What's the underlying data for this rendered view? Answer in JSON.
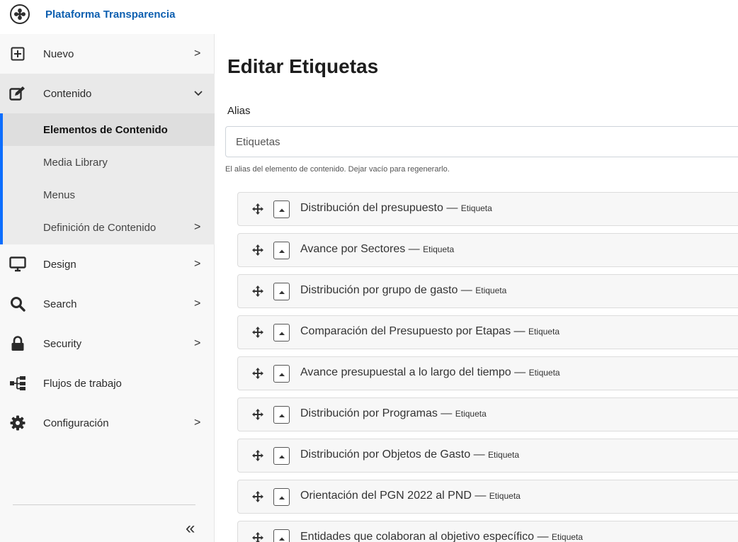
{
  "app": {
    "brand": "Plataforma Transparencia"
  },
  "sidebar": {
    "items": [
      {
        "label": "Nuevo",
        "icon": "plus-square-icon",
        "has_arrow": true
      },
      {
        "label": "Contenido",
        "icon": "edit-icon",
        "expanded": true
      },
      {
        "label": "Design",
        "icon": "monitor-icon",
        "has_arrow": true
      },
      {
        "label": "Search",
        "icon": "search-icon",
        "has_arrow": true
      },
      {
        "label": "Security",
        "icon": "lock-icon",
        "has_arrow": true
      },
      {
        "label": "Flujos de trabajo",
        "icon": "workflow-icon",
        "has_arrow": false
      },
      {
        "label": "Configuración",
        "icon": "gear-icon",
        "has_arrow": true
      }
    ],
    "content_submenu": [
      {
        "label": "Elementos de Contenido",
        "selected": true
      },
      {
        "label": "Media Library"
      },
      {
        "label": "Menus"
      },
      {
        "label": "Definición de Contenido",
        "has_arrow": true
      }
    ],
    "arrow_right": ">",
    "arrow_down": "⌄",
    "collapse_glyph": "«"
  },
  "main": {
    "title": "Editar Etiquetas",
    "alias_label": "Alias",
    "alias_value": "Etiquetas",
    "alias_hint": "El alias del elemento de contenido. Dejar vacío para regenerarlo.",
    "separator": " — ",
    "items": [
      {
        "title": "Distribución del presupuesto",
        "type": "Etiqueta"
      },
      {
        "title": "Avance por Sectores",
        "type": "Etiqueta"
      },
      {
        "title": "Distribución por grupo de gasto",
        "type": "Etiqueta"
      },
      {
        "title": "Comparación del Presupuesto por Etapas",
        "type": "Etiqueta"
      },
      {
        "title": "Avance presupuestal a lo largo del tiempo",
        "type": "Etiqueta"
      },
      {
        "title": "Distribución por Programas",
        "type": "Etiqueta"
      },
      {
        "title": "Distribución por Objetos de Gasto",
        "type": "Etiqueta"
      },
      {
        "title": "Orientación del PGN 2022 al PND",
        "type": "Etiqueta"
      },
      {
        "title": "Entidades que colaboran al objetivo específico",
        "type": "Etiqueta"
      }
    ]
  },
  "colors": {
    "brand": "#0d5fb0",
    "accent": "#0d6efd"
  }
}
